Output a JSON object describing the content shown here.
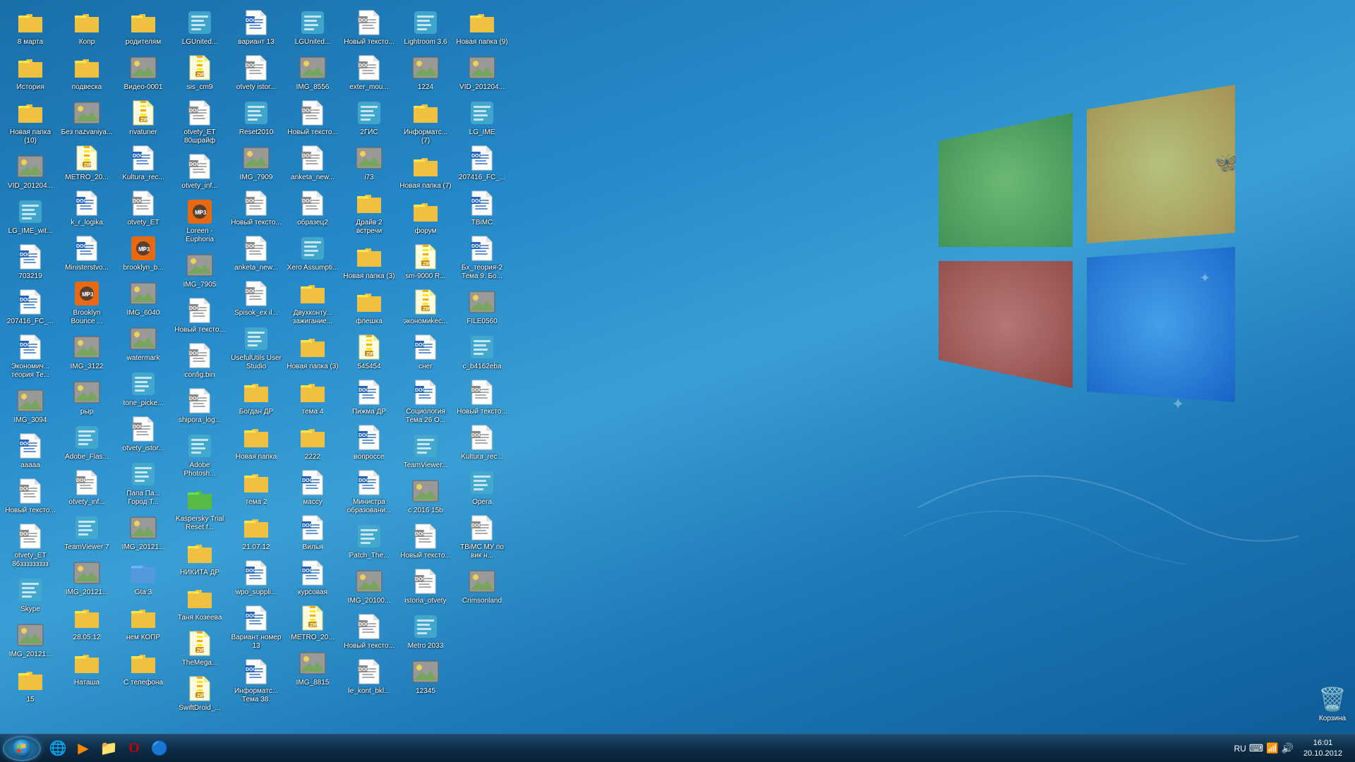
{
  "taskbar": {
    "start_label": "Start",
    "clock": {
      "time": "16:01",
      "date": "20.10.2012"
    },
    "language": "RU",
    "icons": [
      {
        "name": "ie-icon",
        "symbol": "🌐",
        "label": "IE"
      },
      {
        "name": "mediaplayer-icon",
        "symbol": "▶",
        "label": "Media"
      },
      {
        "name": "explorer-icon",
        "symbol": "📁",
        "label": "Explorer"
      },
      {
        "name": "opera-icon",
        "symbol": "O",
        "label": "Opera"
      },
      {
        "name": "unknown-icon",
        "symbol": "🔵",
        "label": ""
      }
    ]
  },
  "desktop": {
    "icons": [
      {
        "id": "8marta",
        "label": "8 марта",
        "type": "folder-yellow"
      },
      {
        "id": "istoriya",
        "label": "История",
        "type": "folder-yellow"
      },
      {
        "id": "novaya-papka-10",
        "label": "Новая папка (10)",
        "type": "folder-yellow"
      },
      {
        "id": "vid2012004",
        "label": "VID_201204...",
        "type": "img"
      },
      {
        "id": "lg-ime",
        "label": "LG_IME_wit...",
        "type": "exe"
      },
      {
        "id": "703219",
        "label": "703219",
        "type": "doc-word"
      },
      {
        "id": "207416-fc",
        "label": "207416_FC_...",
        "type": "doc-word"
      },
      {
        "id": "ekonomich",
        "label": "Экономич... теория Те...",
        "type": "doc-word"
      },
      {
        "id": "img3094",
        "label": "IMG_3094",
        "type": "img"
      },
      {
        "id": "aaaaa",
        "label": "ааааа",
        "type": "doc-word"
      },
      {
        "id": "novy-text",
        "label": "Новый тексто...",
        "type": "doc-white"
      },
      {
        "id": "otvety-et",
        "label": "otvety_ET 86ззззззззз",
        "type": "doc-white"
      },
      {
        "id": "skype",
        "label": "Skype",
        "type": "exe"
      },
      {
        "id": "img20121",
        "label": "IMG_20121...",
        "type": "img"
      },
      {
        "id": "15",
        "label": "15",
        "type": "folder-yellow"
      },
      {
        "id": "kopr",
        "label": "Копр",
        "type": "folder-yellow"
      },
      {
        "id": "podvesqa",
        "label": "подвеска",
        "type": "folder-yellow"
      },
      {
        "id": "bez-nazv",
        "label": "Без nazvaniya...",
        "type": "img"
      },
      {
        "id": "metro20",
        "label": "METRO_20...",
        "type": "zip"
      },
      {
        "id": "kr-logika",
        "label": "k_r_logika",
        "type": "doc-word"
      },
      {
        "id": "ministerstvo",
        "label": "Ministerstvo...",
        "type": "doc-word"
      },
      {
        "id": "brooklyn",
        "label": "Brooklyn Bounce ...",
        "type": "mp3"
      },
      {
        "id": "img3122",
        "label": "IMG_3122",
        "type": "img"
      },
      {
        "id": "ryp",
        "label": "рыр",
        "type": "img"
      },
      {
        "id": "adobe-flash",
        "label": "Adobe_Flas...",
        "type": "exe"
      },
      {
        "id": "otvety-inf",
        "label": "otvety_inf...",
        "type": "doc-white"
      },
      {
        "id": "teamviewer",
        "label": "TeamViewer 7",
        "type": "exe"
      },
      {
        "id": "img20121b",
        "label": "IMG_20121...",
        "type": "img"
      },
      {
        "id": "28-05-12",
        "label": "28.05.12",
        "type": "folder-yellow"
      },
      {
        "id": "natasha",
        "label": "Наташа",
        "type": "folder-yellow"
      },
      {
        "id": "roditelyam",
        "label": "родителям",
        "type": "folder-yellow"
      },
      {
        "id": "video-0001",
        "label": "Видео-0001",
        "type": "img"
      },
      {
        "id": "rivatuner",
        "label": "rivatuner",
        "type": "zip"
      },
      {
        "id": "kultura-rec",
        "label": "Kultura_rec...",
        "type": "doc-word"
      },
      {
        "id": "otvety-et2",
        "label": "otvety_ET",
        "type": "doc-white"
      },
      {
        "id": "brooklyn-b",
        "label": "brooklyn_b...",
        "type": "mp3"
      },
      {
        "id": "img6040",
        "label": "IMG_6040",
        "type": "img"
      },
      {
        "id": "watermark",
        "label": "watermark",
        "type": "img"
      },
      {
        "id": "tone-picker",
        "label": "tone_picke...",
        "type": "exe"
      },
      {
        "id": "otvety-istor",
        "label": "otvety_istor...",
        "type": "doc-white"
      },
      {
        "id": "papa-pa",
        "label": "Папа Па... Город Т...",
        "type": "exe"
      },
      {
        "id": "img20121c",
        "label": "IMG_20121...",
        "type": "img"
      },
      {
        "id": "gta3",
        "label": "Gta 3",
        "type": "folder-blue"
      },
      {
        "id": "nem-kopr",
        "label": "нем КОПР",
        "type": "folder-yellow"
      },
      {
        "id": "s-telefona",
        "label": "С телефона",
        "type": "folder-yellow"
      },
      {
        "id": "lgunited",
        "label": "LGUnited...",
        "type": "exe"
      },
      {
        "id": "sis-cm9",
        "label": "sis_cm9",
        "type": "zip"
      },
      {
        "id": "otvety-et80",
        "label": "otvety_ET 80шрайф",
        "type": "doc-white"
      },
      {
        "id": "otvety-inf2",
        "label": "otvety_inf...",
        "type": "doc-white"
      },
      {
        "id": "loreen",
        "label": "Loreen - Euphoria",
        "type": "mp3"
      },
      {
        "id": "img7905",
        "label": "IMG_7905",
        "type": "img"
      },
      {
        "id": "novy-text2",
        "label": "Новый тексто...",
        "type": "doc-white"
      },
      {
        "id": "config-bin",
        "label": "config.bin",
        "type": "doc-white"
      },
      {
        "id": "shipora-log",
        "label": "shipora_log...",
        "type": "doc-white"
      },
      {
        "id": "adobe-photo",
        "label": "Adobe Photosh...",
        "type": "exe"
      },
      {
        "id": "kaspersky",
        "label": "Kaspersky Trial Reset f...",
        "type": "folder-green"
      },
      {
        "id": "nikita-dp",
        "label": "НИКИТА ДР",
        "type": "folder-yellow"
      },
      {
        "id": "tanya",
        "label": "Таня Козеева",
        "type": "folder-yellow"
      },
      {
        "id": "themega",
        "label": "TheMega...",
        "type": "zip"
      },
      {
        "id": "swiftdroid",
        "label": "SwiftDroid_...",
        "type": "zip"
      },
      {
        "id": "variant13",
        "label": "вариант 13",
        "type": "doc-word"
      },
      {
        "id": "otvety-istor2",
        "label": "otvety istor...",
        "type": "doc-white"
      },
      {
        "id": "reset2010",
        "label": "Reset2010",
        "type": "exe"
      },
      {
        "id": "img7909",
        "label": "IMG_7909",
        "type": "img"
      },
      {
        "id": "novy-text3",
        "label": "Новый тексто...",
        "type": "doc-white"
      },
      {
        "id": "anketa-new",
        "label": "anketa_new...",
        "type": "doc-white"
      },
      {
        "id": "spisok-ex",
        "label": "Spisok_ex il...",
        "type": "doc-white"
      },
      {
        "id": "useful-utils",
        "label": "UsefulUtils User Studio",
        "type": "exe"
      },
      {
        "id": "bogdan-dp",
        "label": "Богдан ДР",
        "type": "folder-yellow"
      },
      {
        "id": "novaya-papka",
        "label": "Новая папка",
        "type": "folder-yellow"
      },
      {
        "id": "tema2",
        "label": "тема 2",
        "type": "folder-yellow"
      },
      {
        "id": "21-07-12",
        "label": "21.07.12",
        "type": "folder-yellow"
      },
      {
        "id": "wpo-suppl",
        "label": "wpo_suppli...",
        "type": "doc-word"
      },
      {
        "id": "variant-nom",
        "label": "Вариант номер 13",
        "type": "doc-word"
      },
      {
        "id": "informats-tema",
        "label": "Информатс... Тема 38.",
        "type": "doc-word"
      },
      {
        "id": "lgunited2",
        "label": "LGUnited...",
        "type": "exe"
      },
      {
        "id": "img8556",
        "label": "IMG_8556",
        "type": "img"
      },
      {
        "id": "novy-text4",
        "label": "Новый тексто...",
        "type": "doc-white"
      },
      {
        "id": "anketa-new2",
        "label": "anketa_new...",
        "type": "doc-white"
      },
      {
        "id": "obrazec2",
        "label": "образец2",
        "type": "doc-white"
      },
      {
        "id": "xero-assump",
        "label": "Xero Assumpti...",
        "type": "exe"
      },
      {
        "id": "dvuhkontu",
        "label": "Двухконту... зажигание...",
        "type": "folder-yellow"
      },
      {
        "id": "novaya-papka3",
        "label": "Новая папка (3)",
        "type": "folder-yellow"
      },
      {
        "id": "tema4",
        "label": "тема 4",
        "type": "folder-yellow"
      },
      {
        "id": "2222",
        "label": "2222",
        "type": "folder-yellow"
      },
      {
        "id": "mascu",
        "label": "масcу",
        "type": "doc-word"
      },
      {
        "id": "vilya",
        "label": "Вилья",
        "type": "doc-word"
      },
      {
        "id": "kursovaya",
        "label": "курсовая",
        "type": "doc-word"
      },
      {
        "id": "metro20b",
        "label": "METRO_20...",
        "type": "zip"
      },
      {
        "id": "img8815",
        "label": "IMG_8815",
        "type": "img"
      },
      {
        "id": "novy-text5",
        "label": "Новый тексто...",
        "type": "doc-white"
      },
      {
        "id": "exter-mou",
        "label": "exter_mou...",
        "type": "doc-white"
      },
      {
        "id": "2gis",
        "label": "2ГИС",
        "type": "exe"
      },
      {
        "id": "i73",
        "label": "i73",
        "type": "img"
      },
      {
        "id": "draive2",
        "label": "Драйв 2 встречи",
        "type": "folder-yellow"
      },
      {
        "id": "novaya-papka4",
        "label": "Новая папка (3)",
        "type": "folder-yellow"
      },
      {
        "id": "fleshka",
        "label": "флешка",
        "type": "folder-yellow"
      },
      {
        "id": "545454",
        "label": "545454",
        "type": "zip"
      },
      {
        "id": "pizhma-dp",
        "label": "Пижма ДР",
        "type": "doc-word"
      },
      {
        "id": "voprosce",
        "label": "вопросce",
        "type": "doc-word"
      },
      {
        "id": "ministra-obr",
        "label": "Министра образовани...",
        "type": "doc-word"
      },
      {
        "id": "patch-the",
        "label": "Patch_The...",
        "type": "exe"
      },
      {
        "id": "img20100",
        "label": "IMG_20100...",
        "type": "img"
      },
      {
        "id": "novy-text6",
        "label": "Новый тексто...",
        "type": "doc-white"
      },
      {
        "id": "le-kont-bkl",
        "label": "le_kont_bkl...",
        "type": "doc-white"
      },
      {
        "id": "lightroom",
        "label": "Lightroom 3.6",
        "type": "exe"
      },
      {
        "id": "1224",
        "label": "1224",
        "type": "img"
      },
      {
        "id": "informats",
        "label": "Информатс... (7)",
        "type": "folder-yellow"
      },
      {
        "id": "novaya-papka7",
        "label": "Новая папка (7)",
        "type": "folder-yellow"
      },
      {
        "id": "forum",
        "label": "форум",
        "type": "folder-yellow"
      },
      {
        "id": "sm9000",
        "label": "sm-9000 R...",
        "type": "zip"
      },
      {
        "id": "ekonomices",
        "label": "экономиkес...",
        "type": "zip"
      },
      {
        "id": "ones",
        "label": "снег",
        "type": "doc-word"
      },
      {
        "id": "sociologiya",
        "label": "Социология Тема 26 О...",
        "type": "doc-word"
      },
      {
        "id": "teamviewer2",
        "label": "TeamViewer...",
        "type": "exe"
      },
      {
        "id": "c2016b",
        "label": "c 2016 15b",
        "type": "img"
      },
      {
        "id": "novy-text7",
        "label": "Новый тексто...",
        "type": "doc-white"
      },
      {
        "id": "istoria-otvety",
        "label": "istoria_otvety",
        "type": "doc-white"
      },
      {
        "id": "metro2033",
        "label": "Metro 2033",
        "type": "exe"
      },
      {
        "id": "12345",
        "label": "12345",
        "type": "img"
      },
      {
        "id": "novaya-papka9",
        "label": "Новая папка (9)",
        "type": "folder-yellow"
      },
      {
        "id": "vid20124",
        "label": "VID_201204...",
        "type": "img"
      },
      {
        "id": "lg-ime2",
        "label": "LG_IME",
        "type": "exe"
      },
      {
        "id": "207416-fc2",
        "label": "207416_FC_...",
        "type": "doc-word"
      },
      {
        "id": "tbimc",
        "label": "ТВіМС",
        "type": "doc-word"
      },
      {
        "id": "bx-teoriya",
        "label": "Бх_теория-2 Тема 9. Бо...",
        "type": "doc-word"
      },
      {
        "id": "file0560",
        "label": "FILE0560",
        "type": "img"
      },
      {
        "id": "c-b4162eba",
        "label": "c_b4162eba",
        "type": "exe"
      },
      {
        "id": "novy-text8",
        "label": "Новый тексто...",
        "type": "doc-white"
      },
      {
        "id": "kultura-rec2",
        "label": "Kultura_rec...",
        "type": "doc-white"
      },
      {
        "id": "opera",
        "label": "Opera",
        "type": "exe"
      },
      {
        "id": "tbimc-mu",
        "label": "ТВіМС МУ по вик н...",
        "type": "doc-white"
      },
      {
        "id": "crimsonland",
        "label": "Crimsonland",
        "type": "img"
      }
    ]
  },
  "recycle_bin": {
    "label": "Корзина"
  }
}
